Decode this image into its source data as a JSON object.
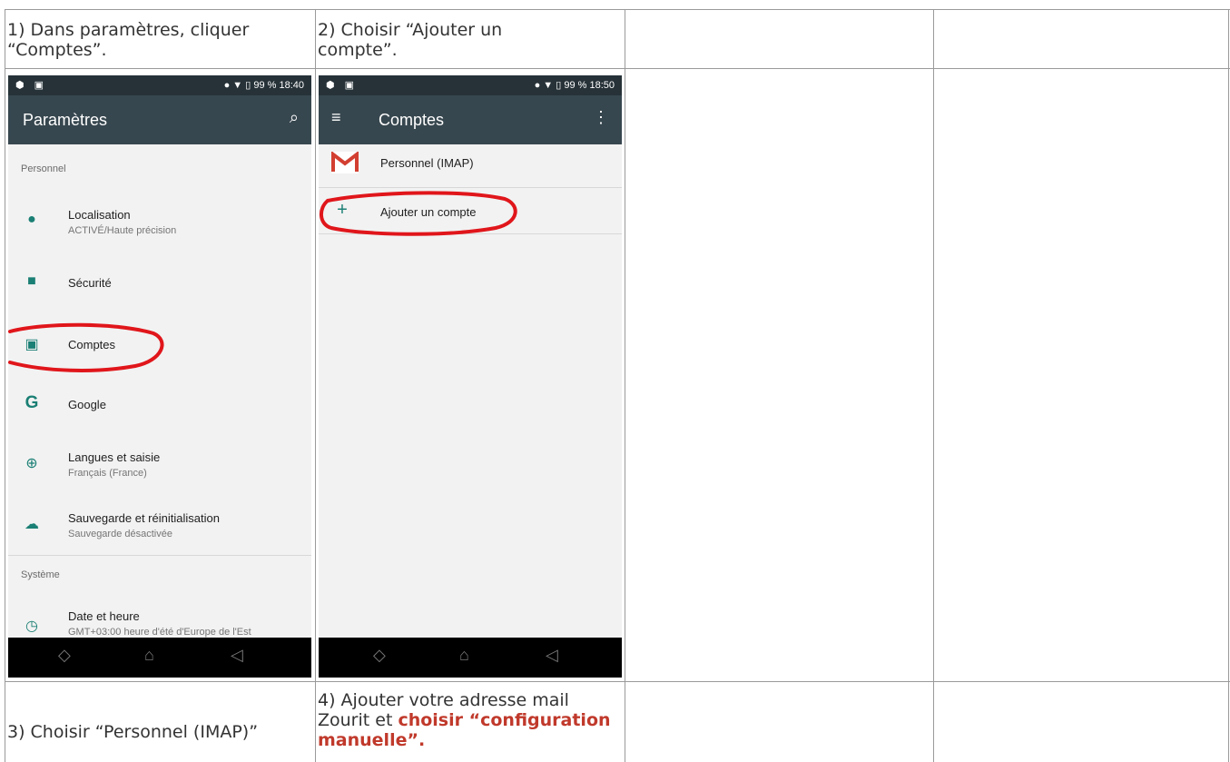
{
  "table": {
    "cell_1_1": "1) Dans paramètres, cliquer “Comptes”.",
    "cell_1_2": "2) Choisir “Ajouter un compte”.",
    "cell_3_1": "3) Choisir “Personnel (IMAP)”",
    "cell_3_2_plain": "4) Ajouter votre adresse mail Zourit et",
    "cell_3_2_highlight": "choisir “configuration manuelle”."
  },
  "phone1": {
    "status_right": "99 %  18:40",
    "appbar_title": "Paramètres",
    "section_personal": "Personnel",
    "items": [
      {
        "icon": "location-pin-icon",
        "title": "Localisation",
        "subtitle": "ACTIVÉ/Haute précision"
      },
      {
        "icon": "lock-icon",
        "title": "Sécurité",
        "subtitle": ""
      },
      {
        "icon": "account-box-icon",
        "title": "Comptes",
        "subtitle": ""
      },
      {
        "icon": "google-icon",
        "title": "Google",
        "subtitle": ""
      },
      {
        "icon": "globe-icon",
        "title": "Langues et saisie",
        "subtitle": "Français (France)"
      },
      {
        "icon": "cloud-upload-icon",
        "title": "Sauvegarde et réinitialisation",
        "subtitle": "Sauvegarde désactivée"
      }
    ],
    "section_system": "Système",
    "system_items": [
      {
        "icon": "clock-icon",
        "title": "Date et heure",
        "subtitle": "GMT+03:00 heure d'été d'Europe de l'Est"
      }
    ]
  },
  "phone2": {
    "status_right": "99 %  18:50",
    "appbar_title": "Comptes",
    "account_label": "Personnel (IMAP)",
    "add_account_label": "Ajouter un compte"
  },
  "colors": {
    "statusbar": "#263238",
    "appbar": "#37474f",
    "accent": "#1a7f74",
    "annotation": "#e0161b",
    "highlight_text": "#c0392b"
  }
}
